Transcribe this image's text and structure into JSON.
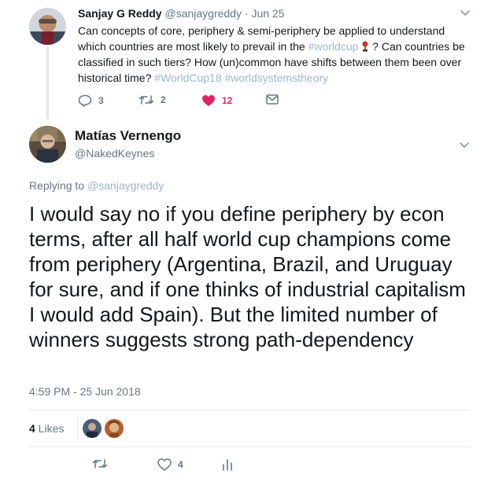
{
  "parent_tweet": {
    "name": "Sanjay G Reddy",
    "handle": "@sanjaygreddy",
    "separator": " · ",
    "date": "Jun 25",
    "text_parts": {
      "a": "Can concepts of core, periphery & semi-periphery be applied to understand which countries are most likely to prevail in the ",
      "hashtag1": "#worldcup",
      "b": " ? Can countries be classified in such tiers? How (un)common have shifts between them been over historical time? ",
      "hashtag2": "#WorldCup18",
      "c": " ",
      "hashtag3": "#worldsystemstheory"
    },
    "replies": "3",
    "retweets": "2",
    "likes": "12"
  },
  "main_tweet": {
    "name": "Matías Vernengo",
    "handle": "@NakedKeynes",
    "replying_label": "Replying to ",
    "replying_handle": "@sanjaygreddy",
    "text": "I would say no if you define periphery by econ terms, after all half world cup champions come from periphery (Argentina, Brazil, and Uruguay for sure, and if one thinks of industrial capitalism I would add Spain). But the limited number of winners suggests strong path-dependency",
    "timestamp": "4:59 PM - 25 Jun 2018",
    "likes_count": "4",
    "likes_label": " Likes",
    "bottom_likes": "4"
  },
  "colors": {
    "link": "#9fb6c8",
    "like_red": "#e0245e",
    "muted": "#657786",
    "divider": "#e6ecf0"
  },
  "icons": [
    "reply-icon",
    "retweet-icon",
    "heart-icon",
    "message-icon",
    "chevron-down-icon",
    "analytics-icon",
    "trophy-emoji"
  ]
}
